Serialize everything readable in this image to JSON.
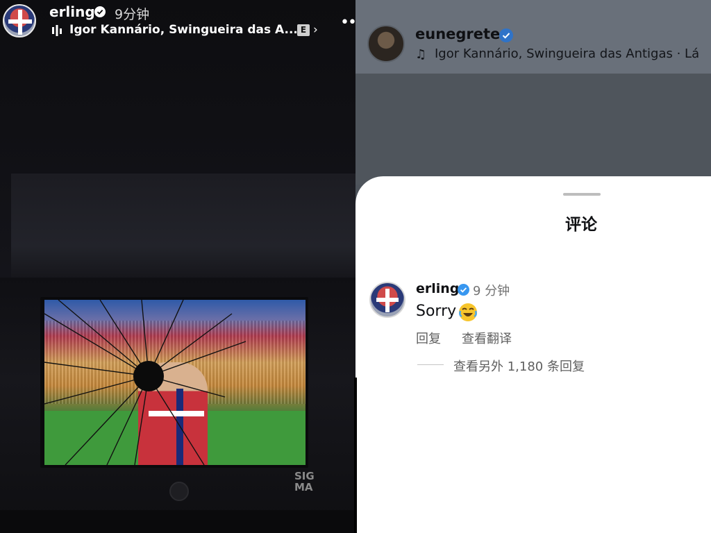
{
  "story": {
    "username": "erling",
    "time": "9分钟",
    "track": "Igor Kannário, Swingueira das A...",
    "explicit_badge": "E",
    "chevron": "›",
    "more_icon": "••",
    "tv_brand": "SIG\nMA"
  },
  "reel": {
    "username": "eunegrete",
    "music_icon": "♫",
    "track": "Igor Kannário, Swingueira das Antigas · Lá"
  },
  "comments": {
    "title": "评论",
    "comment": {
      "username": "erling",
      "time": "9 分钟",
      "text": "Sorry",
      "reply_label": "回复",
      "translate_label": "查看翻译",
      "more_replies": "查看另外 1,180 条回复"
    }
  },
  "colors": {
    "verified": "#3897f0",
    "sheet_bg": "#ffffff",
    "header_bg": "#69707a"
  }
}
